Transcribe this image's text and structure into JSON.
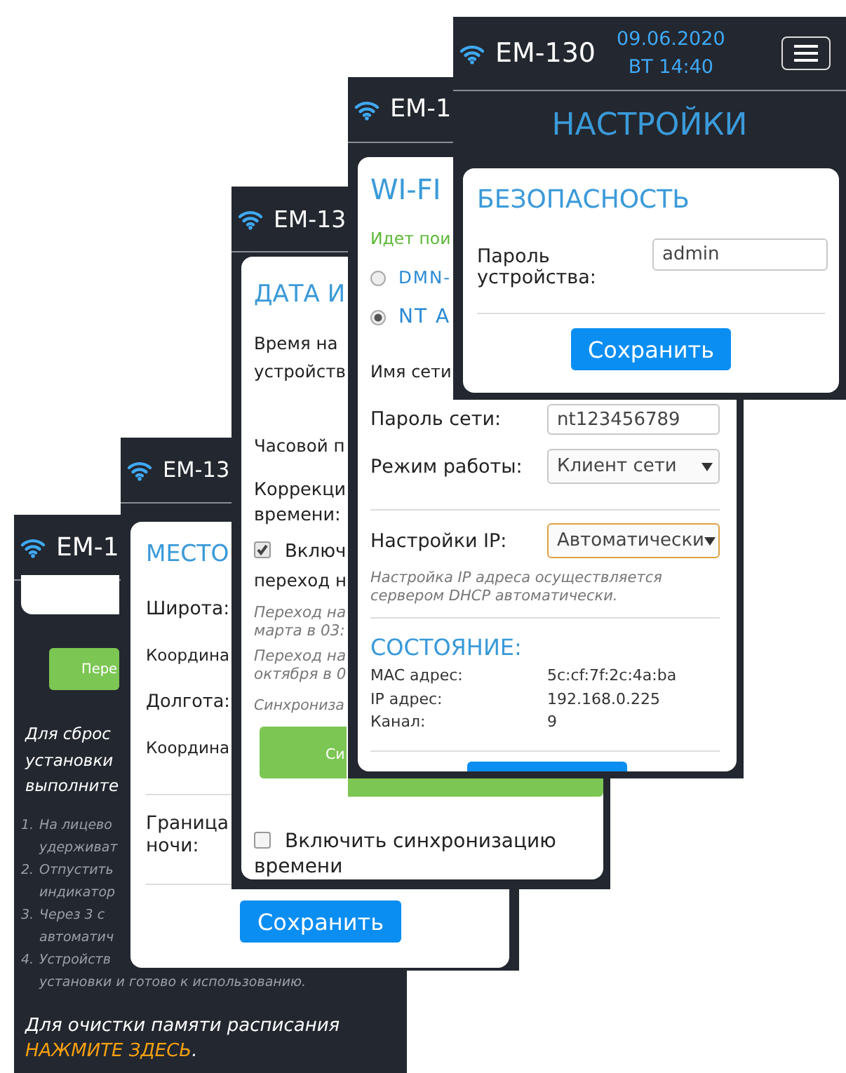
{
  "screens": [
    {
      "kind": "reset",
      "title": "EM-1",
      "button": "Пере",
      "intro": [
        "Для сброс",
        "установки",
        "выполните"
      ],
      "steps": [
        {
          "number": "1.",
          "lines": [
            "На лицево",
            "удерживат"
          ]
        },
        {
          "number": "2.",
          "lines": [
            "Отпустить",
            "индикатор"
          ]
        },
        {
          "number": "3.",
          "lines": [
            "Через 3 с",
            "автоматич"
          ]
        },
        {
          "number": "4.",
          "lines": [
            "Устройств",
            "установки и готово к использованию."
          ]
        }
      ],
      "clear_note": {
        "text": "Для очистки памяти расписания",
        "link": "НАЖМИТЕ ЗДЕСЬ",
        "end": "."
      }
    },
    {
      "kind": "location",
      "title": "EM-13",
      "heading": "МЕСТО",
      "fields": [
        "Широта:",
        "Координа",
        "Долгота:",
        "Координа"
      ],
      "night_label": [
        "Граница",
        "ночи:"
      ],
      "save": "Сохранить"
    },
    {
      "kind": "datetime",
      "title": "EM-13",
      "heading": "ДАТА И",
      "device_time_label": [
        "Время на",
        "устройств"
      ],
      "timezone_label": "Часовой п",
      "correction_label": [
        "Коррекци",
        "времени:"
      ],
      "dst": {
        "checked": true,
        "label": [
          "Включ",
          "переход н"
        ]
      },
      "notes": [
        [
          "Переход на",
          "марта в 03:"
        ],
        [
          "Переход на",
          "октября в 0"
        ]
      ],
      "sync_note": "Синхрониза",
      "sync_button": "Си",
      "sync": {
        "checked": false,
        "label": [
          "Включить синхронизацию",
          "времени"
        ]
      }
    },
    {
      "kind": "wifi",
      "title": "EM-1",
      "heading": "WI-FI",
      "scan_status": "Идет пои",
      "networks": [
        {
          "name": "DMN-",
          "selected": false
        },
        {
          "name": "NT A",
          "selected": true
        }
      ],
      "ssid_label": "Имя сети",
      "password": {
        "label": "Пароль сети:",
        "value": "nt123456789"
      },
      "mode": {
        "label": "Режим работы:",
        "value": "Клиент сети",
        "focused": false
      },
      "ip": {
        "label": "Настройки IP:",
        "value": "Автоматически",
        "focused": true
      },
      "ip_note": [
        "Настройка IP адреса осуществляется",
        "сервером DHCP автоматически."
      ],
      "status_heading": "СОСТОЯНИЕ:",
      "status": [
        {
          "label": "MAC адрес:",
          "value": "5c:cf:7f:2c:4a:ba"
        },
        {
          "label": "IP адрес:",
          "value": "192.168.0.225"
        },
        {
          "label": "Канал:",
          "value": "9"
        }
      ]
    },
    {
      "kind": "settings",
      "title": "EM-130",
      "date": "09.06.2020",
      "day_time": "ВТ 14:40",
      "page_title": "НАСТРОЙКИ",
      "heading": "БЕЗОПАСНОСТЬ",
      "password": {
        "label": [
          "Пароль",
          "устройства:"
        ],
        "value": "admin"
      },
      "save": "Сохранить"
    }
  ]
}
